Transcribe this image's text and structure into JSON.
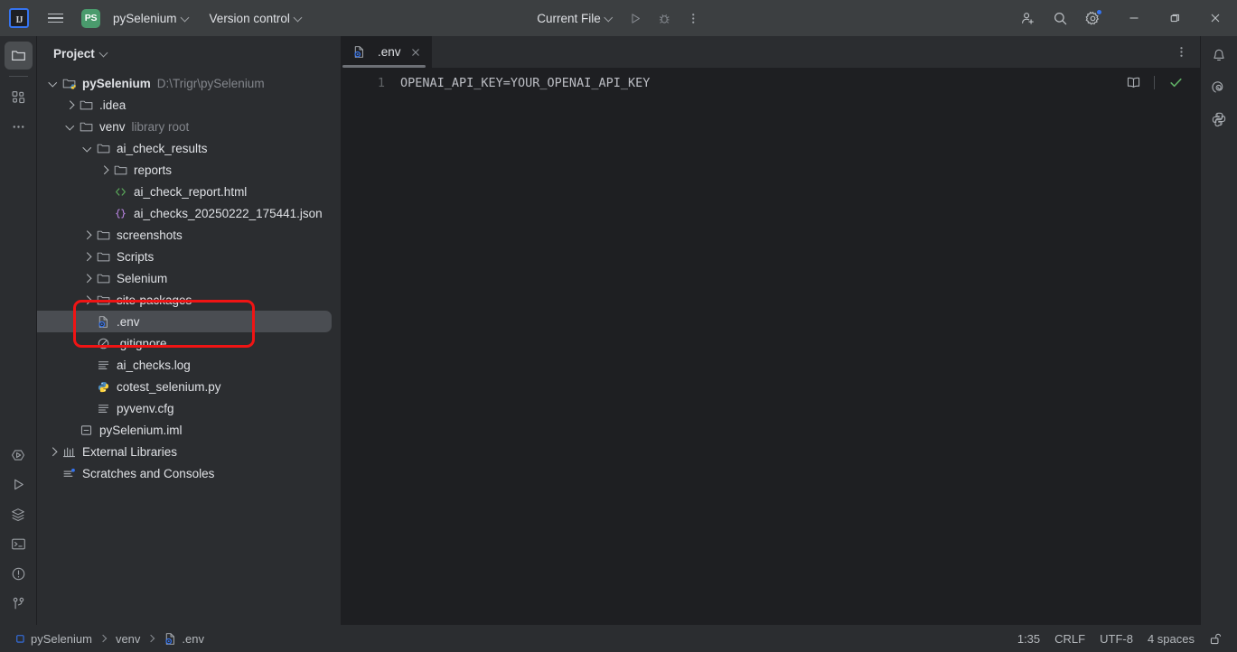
{
  "titlebar": {
    "logo_label": "IJ",
    "menu_icon": "hamburger-menu-icon",
    "project_badge": "PS",
    "project_name": "pySelenium",
    "version_control": "Version control",
    "run_config": "Current File",
    "icons": {
      "run": "run-icon",
      "debug": "debug-icon",
      "more": "more-vertical-icon",
      "add_user": "add-user-icon",
      "search": "search-icon",
      "settings": "gear-icon",
      "minimize": "minimize-icon",
      "maximize": "maximize-icon",
      "close": "close-icon"
    },
    "settings_has_badge": true
  },
  "left_stripe": {
    "top": [
      {
        "name": "project-tool-window",
        "icon": "folder-icon",
        "active": true
      },
      {
        "name": "structure-tool-window",
        "icon": "structure-icon",
        "active": false
      },
      {
        "name": "more-tool-windows",
        "icon": "ellipsis-icon",
        "active": false
      }
    ],
    "bottom": [
      {
        "name": "run-with-coverage",
        "icon": "coverage-icon"
      },
      {
        "name": "run-tool-window",
        "icon": "run-icon"
      },
      {
        "name": "services-tool-window",
        "icon": "layers-icon"
      },
      {
        "name": "terminal-tool-window",
        "icon": "terminal-icon"
      },
      {
        "name": "problems-tool-window",
        "icon": "warning-circle-icon"
      },
      {
        "name": "version-control-tool-window",
        "icon": "branch-icon"
      }
    ]
  },
  "project_panel": {
    "header": "Project",
    "tree": [
      {
        "id": "pySelenium-root",
        "depth": 0,
        "arrow": "open",
        "icon": "module-folder-icon",
        "label": "pySelenium",
        "bold": true,
        "sub": "D:\\Trigr\\pySelenium"
      },
      {
        "id": "idea",
        "depth": 1,
        "arrow": "closed",
        "icon": "folder-icon",
        "label": ".idea",
        "bold": false,
        "sub": ""
      },
      {
        "id": "venv",
        "depth": 1,
        "arrow": "open",
        "icon": "folder-icon",
        "label": "venv",
        "bold": false,
        "sub": "library root"
      },
      {
        "id": "ai_check_results",
        "depth": 2,
        "arrow": "open",
        "icon": "folder-icon",
        "label": "ai_check_results",
        "bold": false,
        "sub": ""
      },
      {
        "id": "reports",
        "depth": 3,
        "arrow": "closed",
        "icon": "folder-icon",
        "label": "reports",
        "bold": false,
        "sub": ""
      },
      {
        "id": "ai_check_report",
        "depth": 3,
        "arrow": "none",
        "icon": "html-file-icon",
        "label": "ai_check_report.html",
        "bold": false,
        "sub": ""
      },
      {
        "id": "ai_checks_json",
        "depth": 3,
        "arrow": "none",
        "icon": "json-file-icon",
        "label": "ai_checks_20250222_175441.json",
        "bold": false,
        "sub": ""
      },
      {
        "id": "screenshots",
        "depth": 2,
        "arrow": "closed",
        "icon": "folder-icon",
        "label": "screenshots",
        "bold": false,
        "sub": ""
      },
      {
        "id": "scripts",
        "depth": 2,
        "arrow": "closed",
        "icon": "folder-icon",
        "label": "Scripts",
        "bold": false,
        "sub": ""
      },
      {
        "id": "selenium",
        "depth": 2,
        "arrow": "closed",
        "icon": "folder-icon",
        "label": "Selenium",
        "bold": false,
        "sub": ""
      },
      {
        "id": "site_packages",
        "depth": 2,
        "arrow": "closed",
        "icon": "folder-icon",
        "label": "site-packages",
        "bold": false,
        "sub": ""
      },
      {
        "id": "env",
        "depth": 2,
        "arrow": "none",
        "icon": "env-file-icon",
        "label": ".env",
        "bold": false,
        "sub": "",
        "selected": true
      },
      {
        "id": "gitignore",
        "depth": 2,
        "arrow": "none",
        "icon": "gitignore-file-icon",
        "label": ".gitignore",
        "bold": false,
        "sub": ""
      },
      {
        "id": "ai_checks_log",
        "depth": 2,
        "arrow": "none",
        "icon": "text-file-icon",
        "label": "ai_checks.log",
        "bold": false,
        "sub": ""
      },
      {
        "id": "cotest_selenium",
        "depth": 2,
        "arrow": "none",
        "icon": "python-file-icon",
        "label": "cotest_selenium.py",
        "bold": false,
        "sub": ""
      },
      {
        "id": "pyvenv_cfg",
        "depth": 2,
        "arrow": "none",
        "icon": "text-file-icon",
        "label": "pyvenv.cfg",
        "bold": false,
        "sub": ""
      },
      {
        "id": "pyselenium_iml",
        "depth": 1,
        "arrow": "none",
        "icon": "iml-file-icon",
        "label": "pySelenium.iml",
        "bold": false,
        "sub": ""
      },
      {
        "id": "external_libraries",
        "depth": 0,
        "arrow": "closed",
        "icon": "library-icon",
        "label": "External Libraries",
        "bold": false,
        "sub": ""
      },
      {
        "id": "scratches",
        "depth": 0,
        "arrow": "none",
        "icon": "scratches-icon",
        "label": "Scratches and Consoles",
        "bold": false,
        "sub": ""
      }
    ]
  },
  "annotation": {
    "color": "#f01414",
    "target": ".env"
  },
  "editor": {
    "tab": {
      "name": ".env",
      "icon": "env-file-icon",
      "close_icon": "close-icon"
    },
    "tabbar_more_icon": "more-vertical-icon",
    "line_numbers": [
      "1"
    ],
    "lines": [
      "OPENAI_API_KEY=YOUR_OPENAI_API_KEY"
    ],
    "reading_mode_icon": "book-icon",
    "inspection_icon": "checkmark-icon",
    "inspection_color": "#5fad65"
  },
  "right_stripe": [
    {
      "name": "notifications-tool-window",
      "icon": "bell-icon"
    },
    {
      "name": "ai-assistant-tool-window",
      "icon": "spiral-icon"
    },
    {
      "name": "python-console-tool-window",
      "icon": "python-icon"
    }
  ],
  "statusbar": {
    "breadcrumbs": [
      {
        "label": "pySelenium",
        "icon": "module-icon"
      },
      {
        "label": "venv",
        "icon": ""
      },
      {
        "label": ".env",
        "icon": "env-file-icon"
      }
    ],
    "caret_position": "1:35",
    "line_separator": "CRLF",
    "encoding": "UTF-8",
    "indent": "4 spaces",
    "lock_icon": "unlocked-padlock-icon"
  }
}
